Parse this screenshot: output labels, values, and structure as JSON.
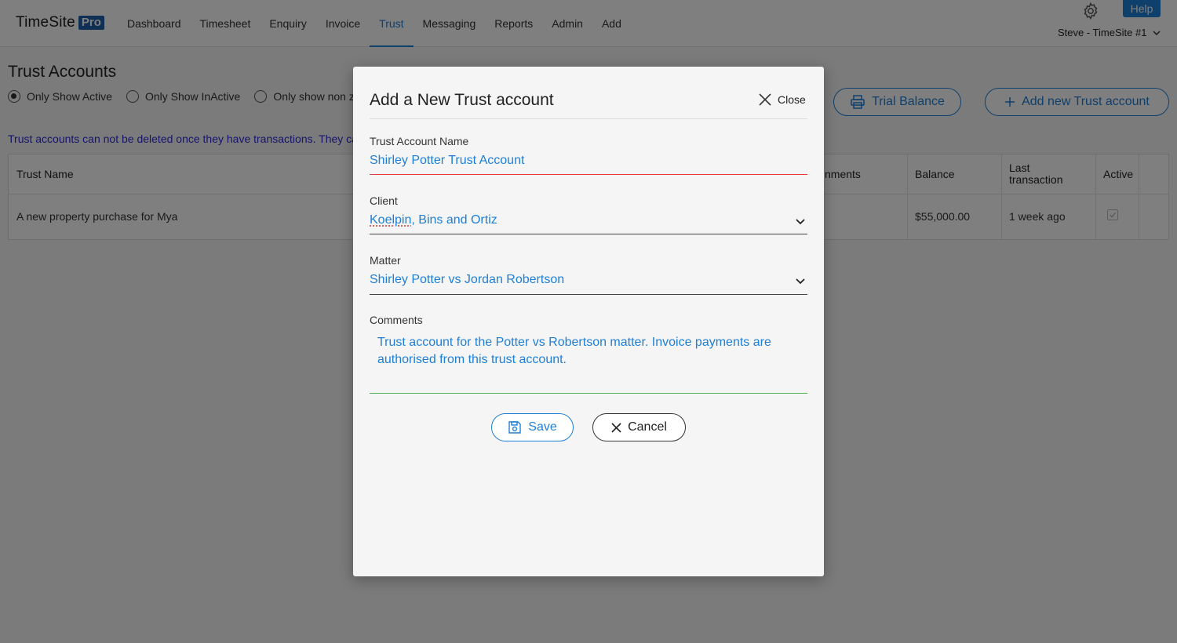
{
  "app": {
    "logo_text": "TimeSite",
    "logo_badge": "Pro",
    "nav": [
      "Dashboard",
      "Timesheet",
      "Enquiry",
      "Invoice",
      "Trust",
      "Messaging",
      "Reports",
      "Admin",
      "Add"
    ],
    "active_nav": "Trust",
    "help_label": "Help",
    "user_label": "Steve - TimeSite #1"
  },
  "page": {
    "title": "Trust Accounts",
    "filters": [
      {
        "label": "Only Show Active",
        "selected": true
      },
      {
        "label": "Only Show InActive",
        "selected": false
      },
      {
        "label": "Only show non z",
        "selected": false
      }
    ],
    "trial_balance_label": "Trial Balance",
    "add_account_label": "Add new Trust account",
    "notice": "Trust accounts can not be deleted once they have transactions. They ca",
    "table": {
      "headers": {
        "trust_name": "Trust Name",
        "comments": "nments",
        "balance": "Balance",
        "last_transaction_1": "Last",
        "last_transaction_2": "transaction",
        "active": "Active"
      },
      "rows": [
        {
          "trust_name": "A new property purchase for Mya",
          "balance": "$55,000.00",
          "last_transaction": "1 week ago",
          "active": true
        }
      ]
    }
  },
  "dialog": {
    "title": "Add a New Trust account",
    "close_label": "Close",
    "account_name_label": "Trust Account Name",
    "account_name_value": "Shirley Potter Trust Account",
    "client_label": "Client",
    "client_value_part1": "Koelpin",
    "client_value_part2": ", Bins and Ortiz",
    "matter_label": "Matter",
    "matter_value": "Shirley Potter vs Jordan Robertson",
    "comments_label": "Comments",
    "comments_value": "Trust account for the Potter vs Robertson matter. Invoice payments are authorised from this trust account.",
    "save_label": "Save",
    "cancel_label": "Cancel"
  },
  "colors": {
    "accent": "#1e7fd6",
    "brand": "#1e5fa8",
    "error_underline": "#e53935",
    "valid_underline": "#4caf50"
  }
}
